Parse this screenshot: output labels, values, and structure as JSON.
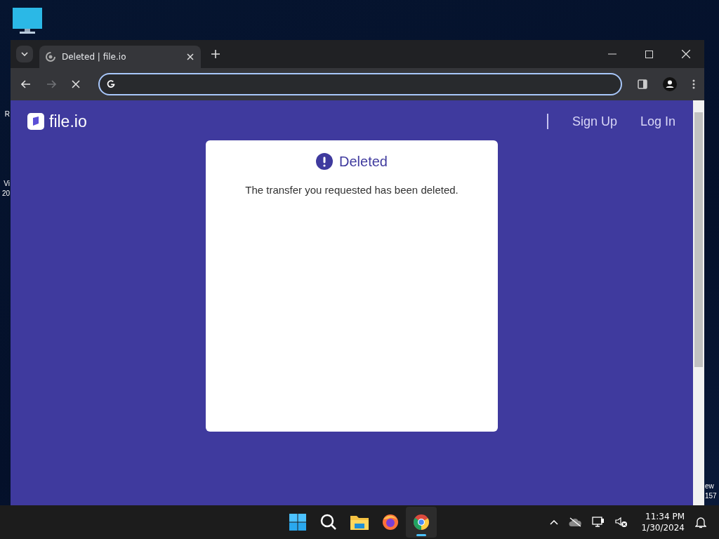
{
  "desktop": {
    "labels": [
      {
        "text": "R"
      },
      {
        "text": "Vi"
      },
      {
        "text": "20"
      },
      {
        "text": "ew"
      },
      {
        "text": "157"
      }
    ]
  },
  "browser": {
    "tabs": [
      {
        "title": "Deleted | file.io",
        "selected": true
      }
    ],
    "nav_buttons": [
      {
        "kind": "back",
        "disabled": false
      },
      {
        "kind": "forward",
        "disabled": true
      },
      {
        "kind": "stop",
        "disabled": false
      }
    ]
  },
  "page": {
    "logo": "file.io",
    "nav_links": [
      {
        "label": "Sign Up"
      },
      {
        "label": "Log In"
      }
    ],
    "card": {
      "title": "Deleted",
      "message": "The transfer you requested has been deleted."
    }
  },
  "taskbar": {
    "apps": [
      {
        "kind": "start",
        "selected": false
      },
      {
        "kind": "search",
        "selected": false
      },
      {
        "kind": "files",
        "selected": false
      },
      {
        "kind": "firefox",
        "selected": false
      },
      {
        "kind": "chrome",
        "selected": true
      }
    ],
    "clock": {
      "time": "11:34 PM",
      "date": "1/30/2024"
    }
  }
}
